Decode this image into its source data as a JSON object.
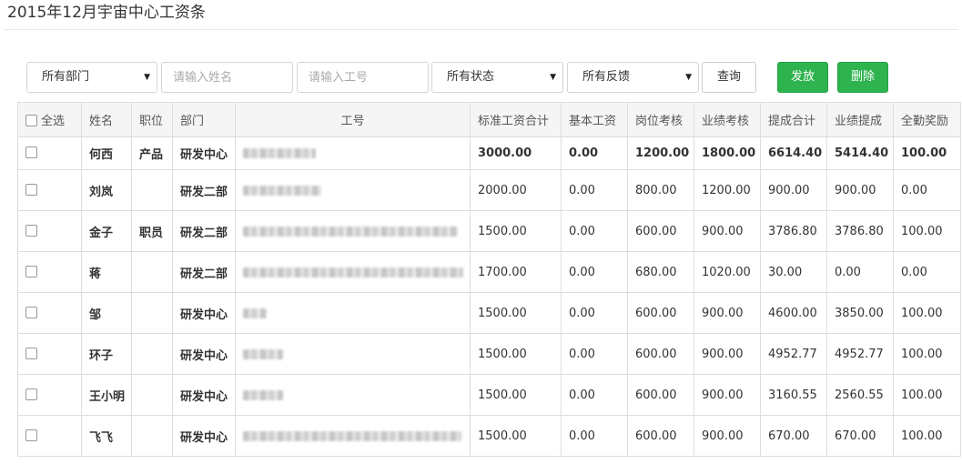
{
  "page": {
    "title": "2015年12月宇宙中心工资条"
  },
  "filters": {
    "department": "所有部门",
    "name_placeholder": "请输入姓名",
    "id_placeholder": "请输入工号",
    "status": "所有状态",
    "feedback": "所有反馈",
    "caret": "▼",
    "query_label": "查询",
    "issue_label": "发放",
    "delete_label": "删除"
  },
  "colors": {
    "primary_green": "#2eb34f",
    "header_bg": "#f5f5f5",
    "border": "#dddddd"
  },
  "icons": {
    "checkbox": "checkbox-icon",
    "dropdown": "caret-down-icon"
  },
  "table": {
    "headers": {
      "select_all": "全选",
      "name": "姓名",
      "position": "职位",
      "department": "部门",
      "employee_id": "工号",
      "standard_total": "标准工资合计",
      "base_salary": "基本工资",
      "position_assessment": "岗位考核",
      "performance_assessment": "业绩考核",
      "commission_total": "提成合计",
      "performance_commission": "业绩提成",
      "attendance_bonus": "全勤奖励"
    },
    "rows": [
      {
        "name": "何西",
        "position": "产品",
        "department": "研发中心",
        "standard_total": "3000.00",
        "base_salary": "0.00",
        "position_assessment": "1200.00",
        "performance_assessment": "1800.00",
        "commission_total": "6614.40",
        "performance_commission": "5414.40",
        "attendance_bonus": "100.00"
      },
      {
        "name": "刘岚",
        "position": "",
        "department": "研发二部",
        "standard_total": "2000.00",
        "base_salary": "0.00",
        "position_assessment": "800.00",
        "performance_assessment": "1200.00",
        "commission_total": "900.00",
        "performance_commission": "900.00",
        "attendance_bonus": "0.00"
      },
      {
        "name": "金子",
        "position": "职员",
        "department": "研发二部",
        "standard_total": "1500.00",
        "base_salary": "0.00",
        "position_assessment": "600.00",
        "performance_assessment": "900.00",
        "commission_total": "3786.80",
        "performance_commission": "3786.80",
        "attendance_bonus": "100.00"
      },
      {
        "name": "蒋",
        "position": "",
        "department": "研发二部",
        "standard_total": "1700.00",
        "base_salary": "0.00",
        "position_assessment": "680.00",
        "performance_assessment": "1020.00",
        "commission_total": "30.00",
        "performance_commission": "0.00",
        "attendance_bonus": "0.00"
      },
      {
        "name": "邹",
        "position": "",
        "department": "研发中心",
        "standard_total": "1500.00",
        "base_salary": "0.00",
        "position_assessment": "600.00",
        "performance_assessment": "900.00",
        "commission_total": "4600.00",
        "performance_commission": "3850.00",
        "attendance_bonus": "100.00"
      },
      {
        "name": "环子",
        "position": "",
        "department": "研发中心",
        "standard_total": "1500.00",
        "base_salary": "0.00",
        "position_assessment": "600.00",
        "performance_assessment": "900.00",
        "commission_total": "4952.77",
        "performance_commission": "4952.77",
        "attendance_bonus": "100.00"
      },
      {
        "name": "王小明",
        "position": "",
        "department": "研发中心",
        "standard_total": "1500.00",
        "base_salary": "0.00",
        "position_assessment": "600.00",
        "performance_assessment": "900.00",
        "commission_total": "3160.55",
        "performance_commission": "2560.55",
        "attendance_bonus": "100.00"
      },
      {
        "name": "飞飞",
        "position": "",
        "department": "研发中心",
        "standard_total": "1500.00",
        "base_salary": "0.00",
        "position_assessment": "600.00",
        "performance_assessment": "900.00",
        "commission_total": "670.00",
        "performance_commission": "670.00",
        "attendance_bonus": "100.00"
      }
    ]
  }
}
